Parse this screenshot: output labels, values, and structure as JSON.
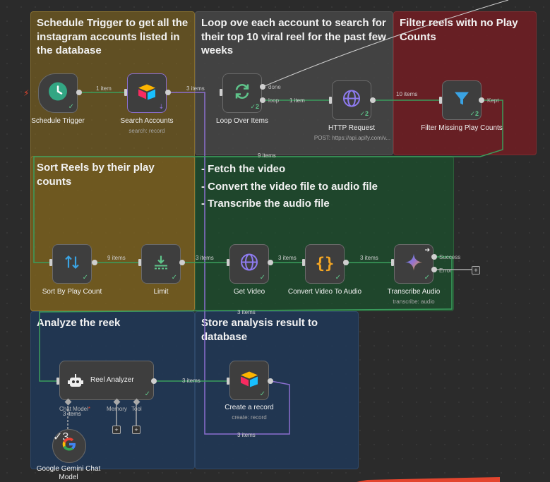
{
  "stickies": {
    "s1": "Schedule Trigger to get all the instagram accounts listed in the database",
    "s2": "Loop ove each account to search for their top 10 viral reel for the past few weeks",
    "s3": "Filter reels with no Play Counts",
    "s4": "Sort Reels by their play counts",
    "s5": "- Fetch the video\n- Convert the video file to audio file\n- Transcribe the audio file",
    "s6": "Analyze the reek",
    "s7": "Store analysis result to database"
  },
  "nodes": {
    "schedule": {
      "label": "Schedule Trigger",
      "icon": "clock-icon"
    },
    "search": {
      "label": "Search Accounts",
      "sub": "search: record",
      "icon": "airtable-icon"
    },
    "loop": {
      "label": "Loop Over Items",
      "badge": "2",
      "icon": "loop-icon"
    },
    "http": {
      "label": "HTTP Request",
      "sub": "POST: https://api.apify.com/v...",
      "badge": "2",
      "icon": "globe-icon"
    },
    "filter": {
      "label": "Filter Missing Play Counts",
      "badge": "2",
      "icon": "filter-icon"
    },
    "sort": {
      "label": "Sort By Play Count",
      "icon": "sort-icon"
    },
    "limit": {
      "label": "Limit",
      "icon": "limit-icon"
    },
    "getvideo": {
      "label": "Get Video",
      "icon": "globe-icon"
    },
    "convert": {
      "label": "Convert Video To Audio",
      "icon": "code-icon"
    },
    "transcribe": {
      "label": "Transcribe Audio",
      "sub": "transcribe: audio",
      "icon": "gemini-icon"
    },
    "analyzer": {
      "label": "Reel Analyzer",
      "icon": "robot-icon"
    },
    "createrecord": {
      "label": "Create a record",
      "sub": "create: record",
      "icon": "airtable-icon"
    },
    "gemini": {
      "label": "Google Gemini Chat Model",
      "badge": "3",
      "icon": "google-icon"
    }
  },
  "edges": {
    "e1": "1 item",
    "e2": "3 items",
    "e3": "1 item",
    "e4": "10 items",
    "e5": "9 items",
    "e6": "9 items",
    "e7": "3 items",
    "e8": "3 items",
    "e9": "3 items",
    "e10": "3 items",
    "e11": "3 items",
    "e12": "3 items",
    "e13": "3 items"
  },
  "handles": {
    "done": "done",
    "loop": "loop",
    "kept": "Kept",
    "success": "Success",
    "error": "Error",
    "chat_model": "Chat Model",
    "memory": "Memory",
    "tool": "Tool"
  },
  "colors": {
    "edge": "#3a9d5d",
    "check": "#5fc48a",
    "accent": "#e3452e"
  }
}
